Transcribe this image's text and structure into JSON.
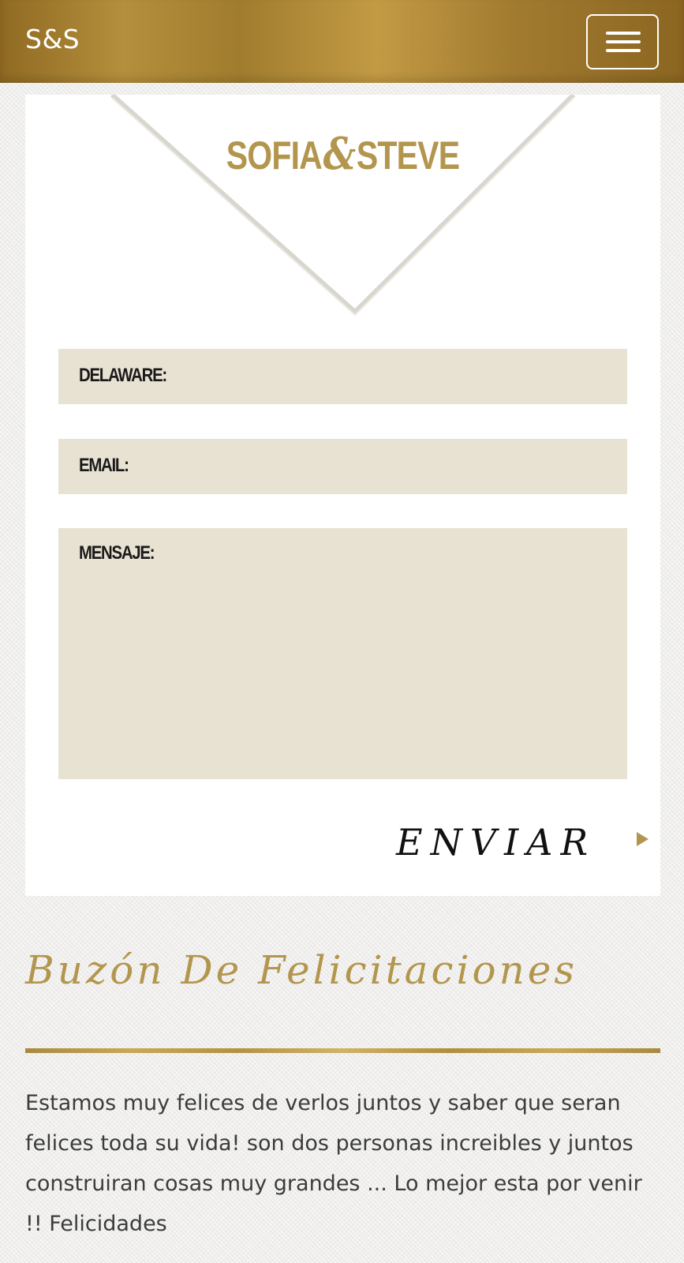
{
  "navbar": {
    "brand": "S&S",
    "menu_icon": "hamburger-menu-icon"
  },
  "logo": {
    "left": "SOFIA",
    "amp": "&",
    "right": "STEVE"
  },
  "form": {
    "name_label": "DELAWARE:",
    "email_label": "EMAIL:",
    "message_label": "MENSAJE:",
    "submit_label": "ENVIAR",
    "submit_icon": "play-arrow-icon"
  },
  "section": {
    "title": "Buzón De Felicitaciones"
  },
  "messages": [
    {
      "text": "Estamos muy felices de verlos juntos y saber que seran felices toda su vida! son dos personas increibles y juntos construiran cosas muy grandes ... Lo mejor esta por venir !! Felicidades"
    }
  ],
  "colors": {
    "gold": "#b3964e",
    "field_bg": "#e8e2d3",
    "page_bg": "#efeeec"
  }
}
